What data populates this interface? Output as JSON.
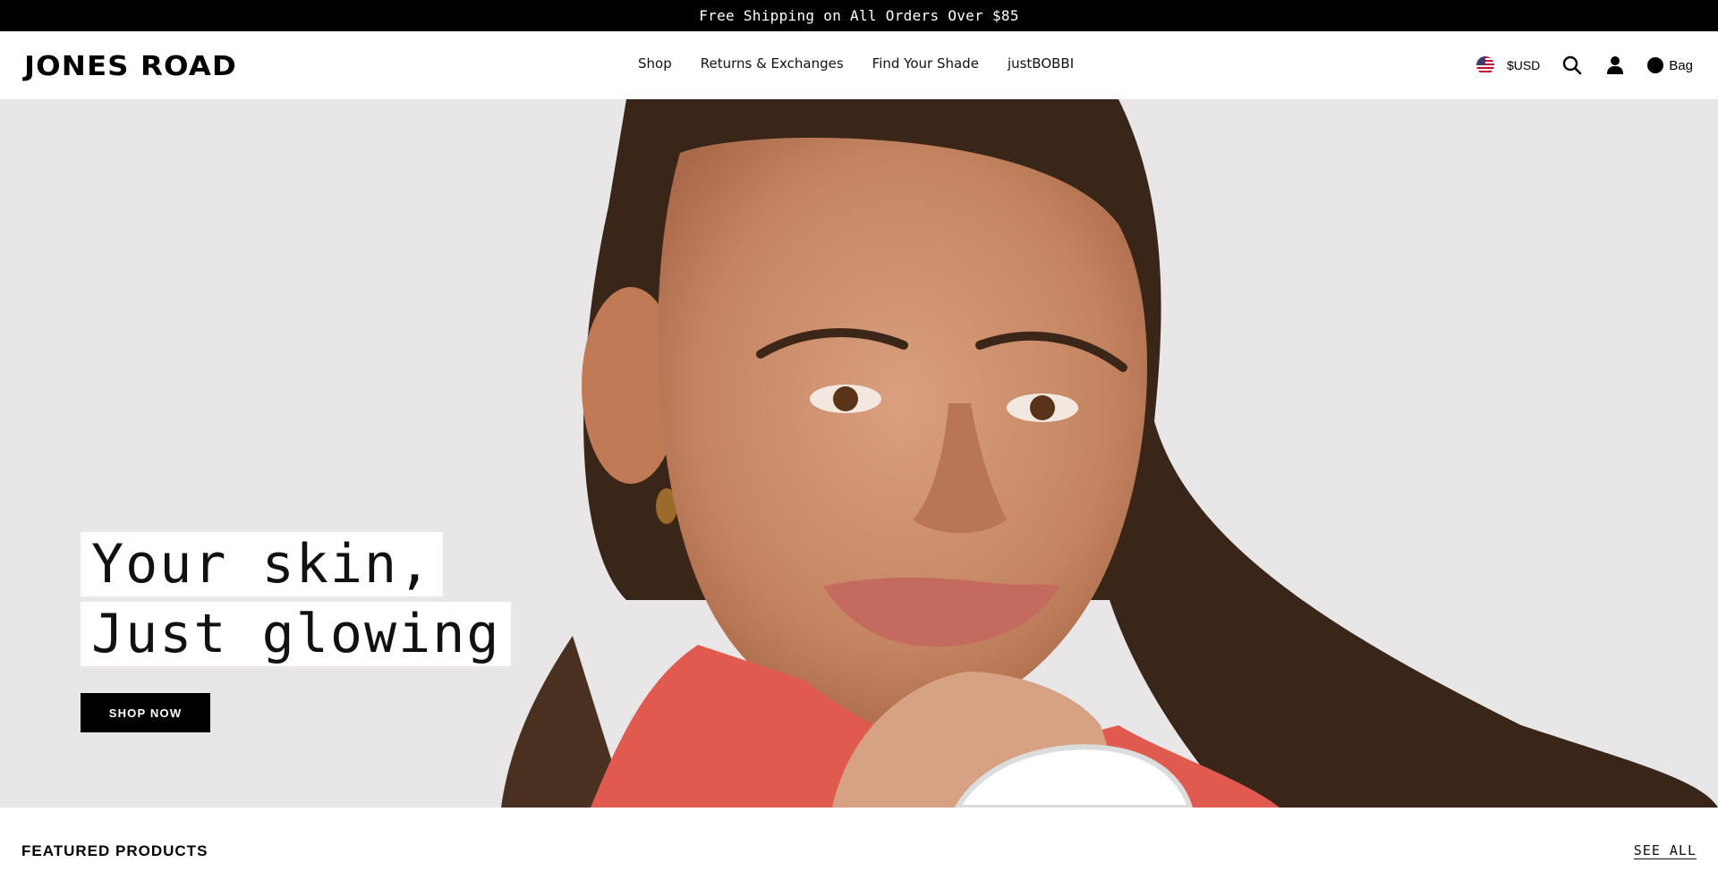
{
  "announcement": {
    "text": "Free Shipping on All Orders Over $85"
  },
  "header": {
    "logo": "JONES ROAD",
    "nav": [
      {
        "label": "Shop"
      },
      {
        "label": "Returns & Exchanges"
      },
      {
        "label": "Find Your Shade"
      },
      {
        "label": "justBOBBI"
      }
    ],
    "currency": {
      "label": "$USD",
      "flag_icon": "us-flag-icon"
    },
    "icons": [
      "search-icon",
      "account-icon"
    ],
    "bag": {
      "label": "Bag"
    }
  },
  "hero": {
    "line1": "Your skin,",
    "line2": "Just glowing",
    "cta": "SHOP NOW"
  },
  "featured": {
    "title": "FEATURED PRODUCTS",
    "see_all": "SEE ALL"
  },
  "colors": {
    "announcement_bg": "#000000",
    "hero_bg": "#e8e6e7",
    "cta_bg": "#000000",
    "shirt": "#e05a4f"
  }
}
